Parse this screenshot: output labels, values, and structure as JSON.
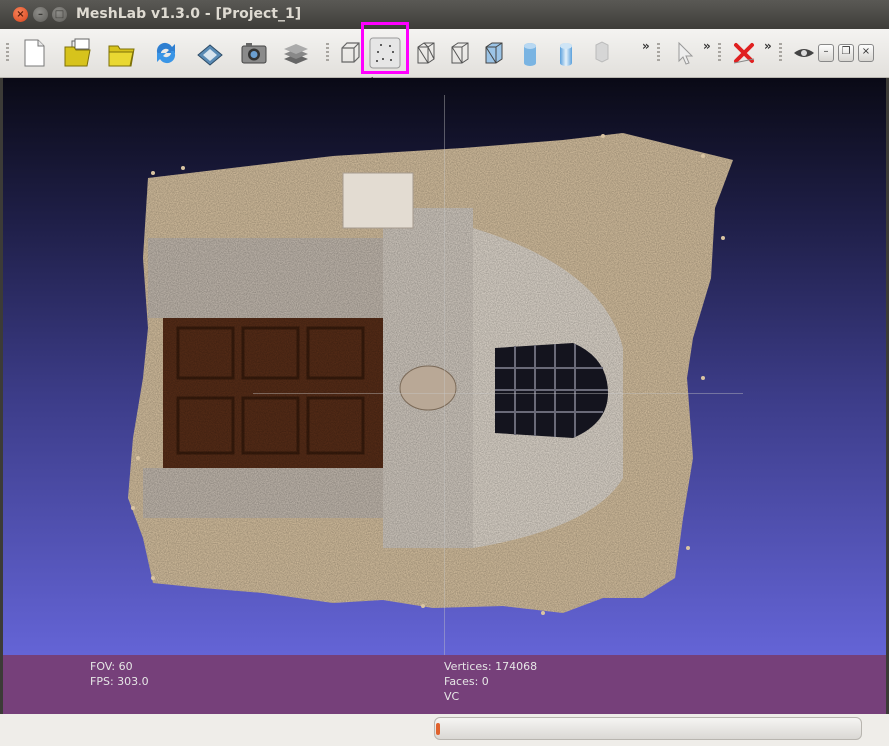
{
  "window": {
    "title": "MeshLab v1.3.0 - [Project_1]"
  },
  "window_controls": [
    "close",
    "minimize",
    "maximize"
  ],
  "toolbar": {
    "more_label": "»",
    "tools": [
      "new-project-icon",
      "open-project-icon",
      "open-mesh-icon",
      "reload-icon",
      "save-icon",
      "snapshot-icon",
      "layers-icon",
      "bounding-box-icon",
      "points-render-icon",
      "wireframe-icon",
      "hidden-lines-icon",
      "flat-lines-icon",
      "flat-shading-icon",
      "smooth-shading-icon",
      "texture-icon",
      "pick-point-icon",
      "delete-icon",
      "quality-icon"
    ]
  },
  "info": {
    "fov": "FOV: 60",
    "fps": "FPS:   303.0",
    "vertices": "Vertices: 174068",
    "faces": "Faces: 0",
    "vc": "VC"
  },
  "status": {
    "progress": 0.01
  },
  "colors": {
    "highlight": "#ff00ff",
    "infobar": "#76407a",
    "progress": "#e0622d"
  }
}
